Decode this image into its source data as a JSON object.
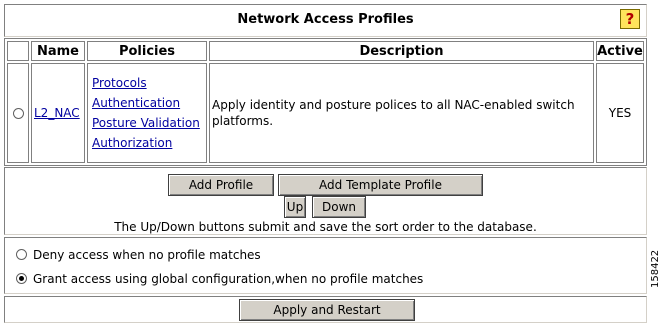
{
  "header": {
    "title": "Network Access Profiles",
    "help_glyph": "?"
  },
  "table": {
    "columns": [
      "",
      "Name",
      "Policies",
      "Description",
      "Active"
    ],
    "rows": [
      {
        "selected": false,
        "name": "L2_NAC",
        "policies": [
          "Protocols",
          "Authentication",
          "Posture Validation",
          "Authorization"
        ],
        "description": "Apply identity and posture polices to all NAC-enabled switch platforms.",
        "active": "YES"
      }
    ]
  },
  "controls": {
    "add_profile": "Add Profile",
    "add_template_profile": "Add Template Profile",
    "up": "Up",
    "down": "Down",
    "hint": "The Up/Down buttons submit and save the sort order to the database."
  },
  "options": [
    {
      "label": "Deny access when no profile matches",
      "selected": false
    },
    {
      "label": "Grant access using global configuration,when no profile matches",
      "selected": true
    }
  ],
  "footer": {
    "apply_restart": "Apply and Restart"
  },
  "figure_code": "158422",
  "colors": {
    "link": "#0000a0",
    "button_face": "#d4d0c8",
    "help_bg": "#ffe45c"
  }
}
